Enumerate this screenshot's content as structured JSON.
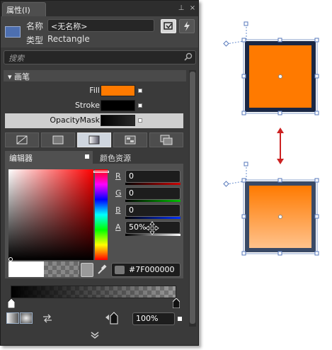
{
  "panel": {
    "tab_title": "属性(I)",
    "pin_glyph": "⊥",
    "close_glyph": "×",
    "name_label": "名称",
    "name_value": "<无名称>",
    "type_label": "类型",
    "type_value": "Rectangle",
    "search_placeholder": "搜索",
    "brush_section": "画笔",
    "brush_rows": [
      {
        "label": "Fill",
        "color": "#ff7a00"
      },
      {
        "label": "Stroke",
        "color": "#000000"
      },
      {
        "label": "OpacityMask",
        "color": "#1a1a1a"
      }
    ],
    "editor_tab": "编辑器",
    "resources_tab": "颜色资源",
    "channels": [
      {
        "label": "R",
        "value": "0",
        "color": "#c00000"
      },
      {
        "label": "G",
        "value": "0",
        "color": "#00a000"
      },
      {
        "label": "B",
        "value": "0",
        "color": "#0020d0"
      },
      {
        "label": "A",
        "value": "50%",
        "color": "#ffffff"
      }
    ],
    "hex_value": "#7F000000",
    "offset_value": "100%"
  },
  "canvas": {
    "top_rect_fill": "#ff7a00",
    "bottom_rect_gradient": [
      "#ff7a00",
      "#ffc28c"
    ],
    "frame_color": "#1a2744",
    "arrow_color": "#cc2222"
  }
}
